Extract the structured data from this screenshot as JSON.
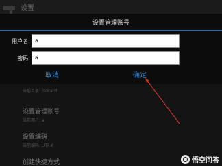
{
  "app": {
    "title": "设置"
  },
  "dialog": {
    "title": "设置管理账号",
    "username": {
      "label": "用户名:",
      "value": "a",
      "placeholder": ""
    },
    "password": {
      "label": "密码:",
      "value": "a",
      "hint": ""
    },
    "cancel_label": "取消",
    "ok_label": "确定"
  },
  "background_list": [
    {
      "main": "",
      "sub": "当前目录: /sdcard"
    },
    {
      "main": "设置管理账号",
      "sub": "当前用户: a"
    },
    {
      "main": "设置编码",
      "sub": "当前编码: UTF-8"
    },
    {
      "main": "创建快捷方式",
      "sub": ""
    }
  ],
  "watermark": {
    "text": "悟空问答"
  },
  "colors": {
    "accent": "#2d8ad6",
    "annotation_arrow": "#c0392b"
  }
}
